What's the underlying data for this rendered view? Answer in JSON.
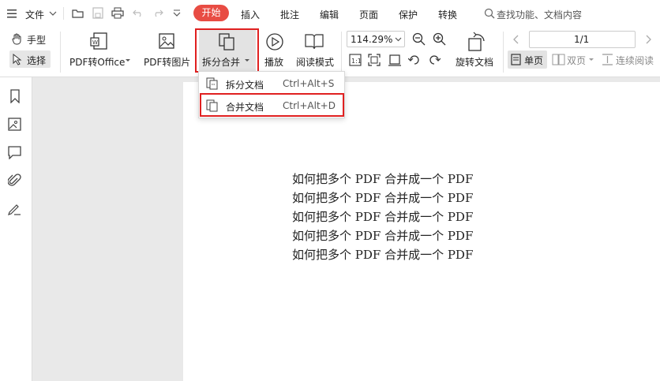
{
  "menubar": {
    "file_label": "文件",
    "tabs": [
      "开始",
      "插入",
      "批注",
      "编辑",
      "页面",
      "保护",
      "转换"
    ],
    "active_tab": "开始",
    "search_placeholder": "查找功能、文档内容"
  },
  "toolbar": {
    "hand_label": "手型",
    "select_label": "选择",
    "pdf_to_office_label": "PDF转Office",
    "pdf_to_image_label": "PDF转图片",
    "split_merge_label": "拆分合并",
    "play_label": "播放",
    "read_mode_label": "阅读模式",
    "zoom_value": "114.29%",
    "rotate_label": "旋转文档",
    "page_value": "1/1",
    "single_page_label": "单页",
    "double_page_label": "双页",
    "continuous_label": "连续阅读"
  },
  "dropdown": {
    "items": [
      {
        "label": "拆分文档",
        "shortcut": "Ctrl+Alt+S"
      },
      {
        "label": "合并文档",
        "shortcut": "Ctrl+Alt+D"
      }
    ]
  },
  "document": {
    "lines": [
      "如何把多个 PDF 合并成一个 PDF",
      "如何把多个 PDF 合并成一个 PDF",
      "如何把多个 PDF 合并成一个 PDF",
      "如何把多个 PDF 合并成一个 PDF",
      "如何把多个 PDF 合并成一个 PDF"
    ]
  },
  "colors": {
    "accent": "#e84c43",
    "highlight_box": "#e02020"
  }
}
